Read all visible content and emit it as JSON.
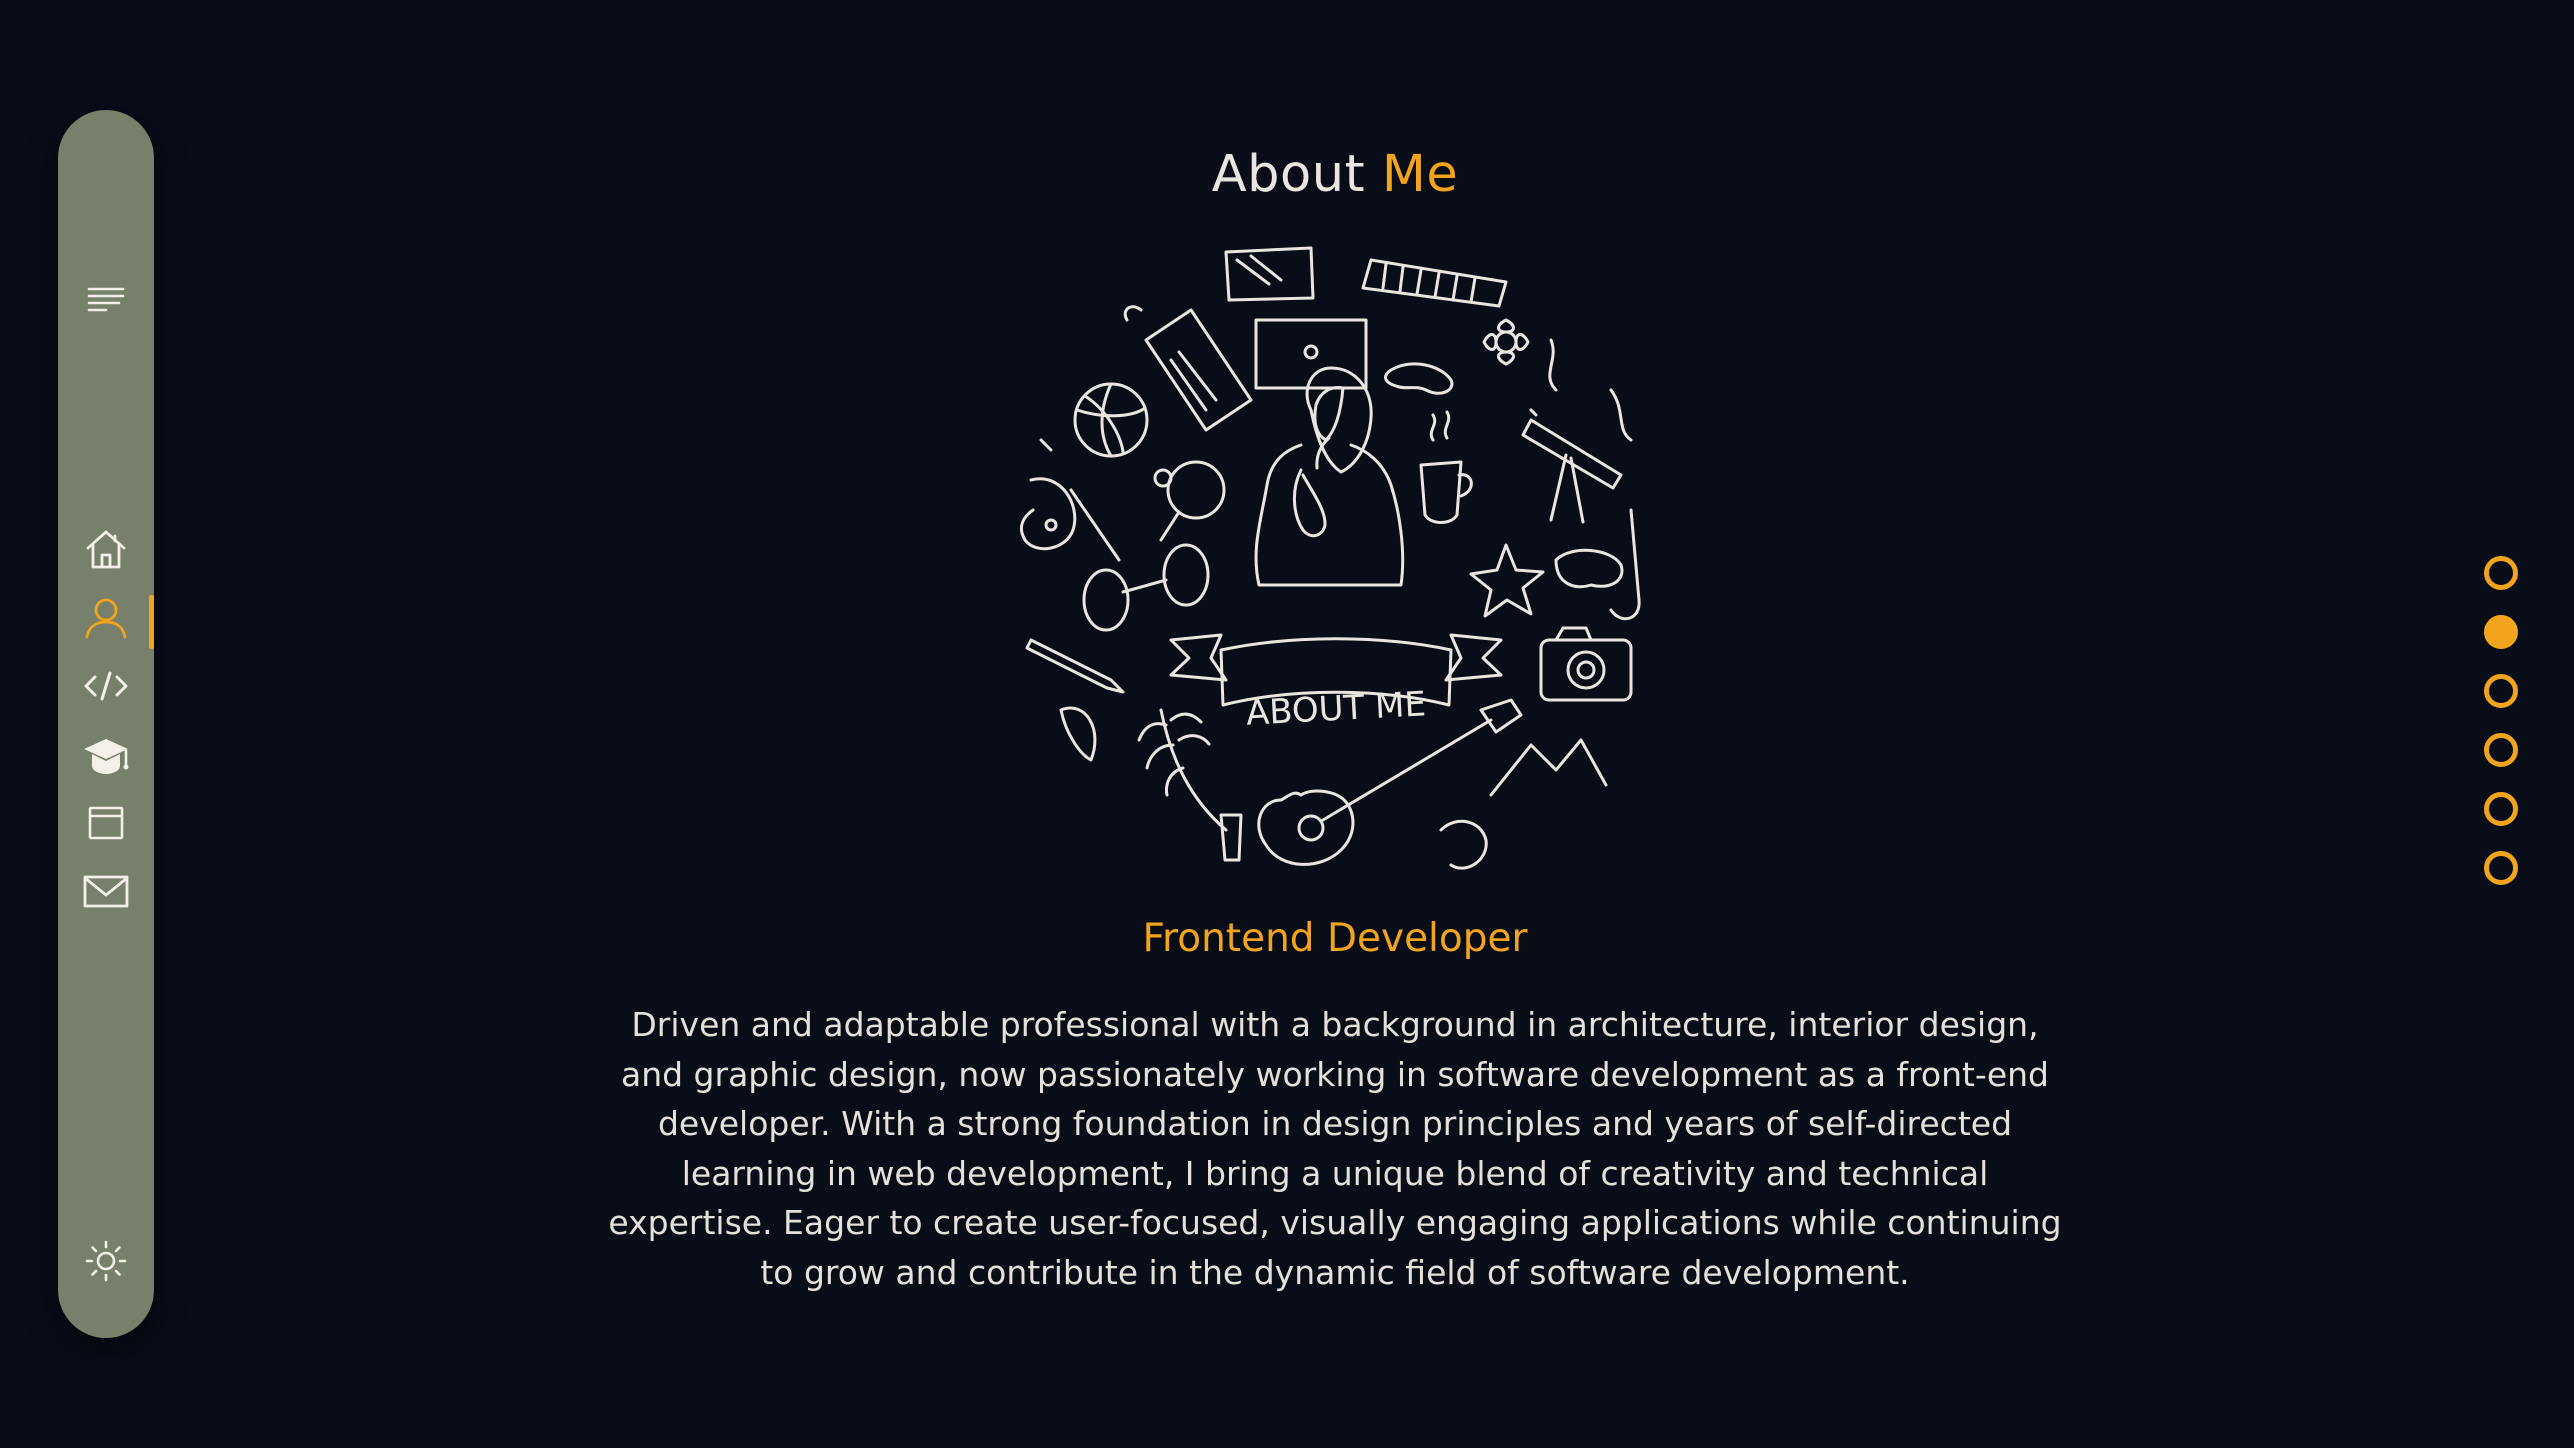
{
  "sidebar": {
    "items": [
      {
        "icon": "menu-icon"
      },
      {
        "icon": "home-icon"
      },
      {
        "icon": "user-icon",
        "active": true
      },
      {
        "icon": "code-icon"
      },
      {
        "icon": "graduation-cap-icon"
      },
      {
        "icon": "browser-window-icon"
      },
      {
        "icon": "mail-icon"
      },
      {
        "icon": "sun-icon"
      }
    ],
    "background_color": "#76806a",
    "active_color": "#f2a41c"
  },
  "header": {
    "title_part1": "About",
    "title_part2": "Me"
  },
  "illustration": {
    "banner_text": "ABOUT ME"
  },
  "profile": {
    "role": "Frontend Developer",
    "bio": "Driven and adaptable professional with a background in architecture, interior design, and graphic design, now passionately working in software development as a front-end developer. With a strong foundation in design principles and years of self-directed learning in web development, I bring a unique blend of creativity and technical expertise. Eager to create user-focused, visually engaging applications while continuing to grow and contribute in the dynamic field of software development."
  },
  "section_nav": {
    "count": 6,
    "active_index": 1
  },
  "colors": {
    "background": "#090d18",
    "accent": "#f2a41c",
    "text": "#e9e6df"
  }
}
